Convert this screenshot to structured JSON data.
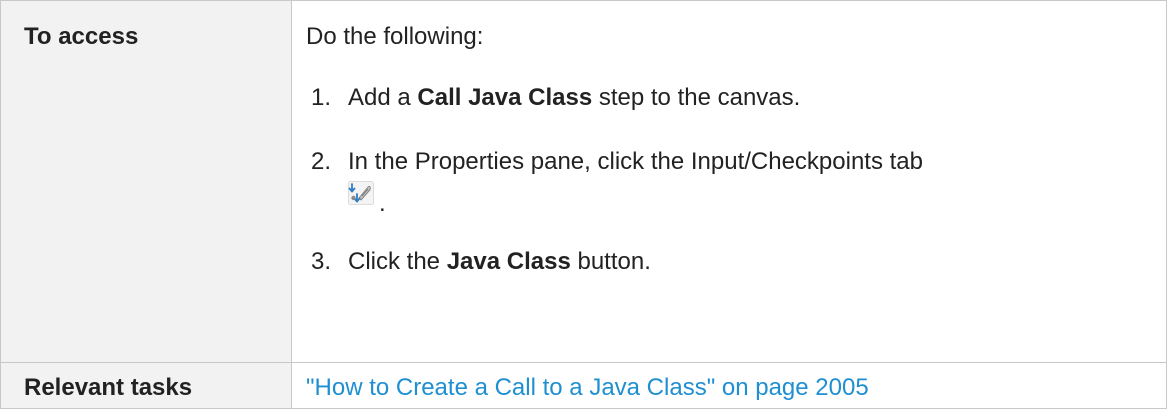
{
  "table": {
    "access_row": {
      "label": "To access",
      "intro": "Do the following:",
      "steps": [
        {
          "number": "1.",
          "before": "Add a ",
          "bold": "Call Java Class",
          "after": " step to the canvas."
        },
        {
          "number": "2.",
          "text": "In the Properties pane, click the Input/Checkpoints tab",
          "icon": "input-checkpoints-tab-icon",
          "after_icon": "."
        },
        {
          "number": "3.",
          "before": "Click the ",
          "bold": "Java Class",
          "after": " button."
        }
      ]
    },
    "tasks_row": {
      "label": "Relevant tasks",
      "link_text": "\"How to Create a Call to a Java Class\" on page 2005"
    }
  },
  "colors": {
    "border": "#c8c8c8",
    "label_background": "#f2f2f2",
    "text": "#222222",
    "link": "#1f8fd1"
  }
}
